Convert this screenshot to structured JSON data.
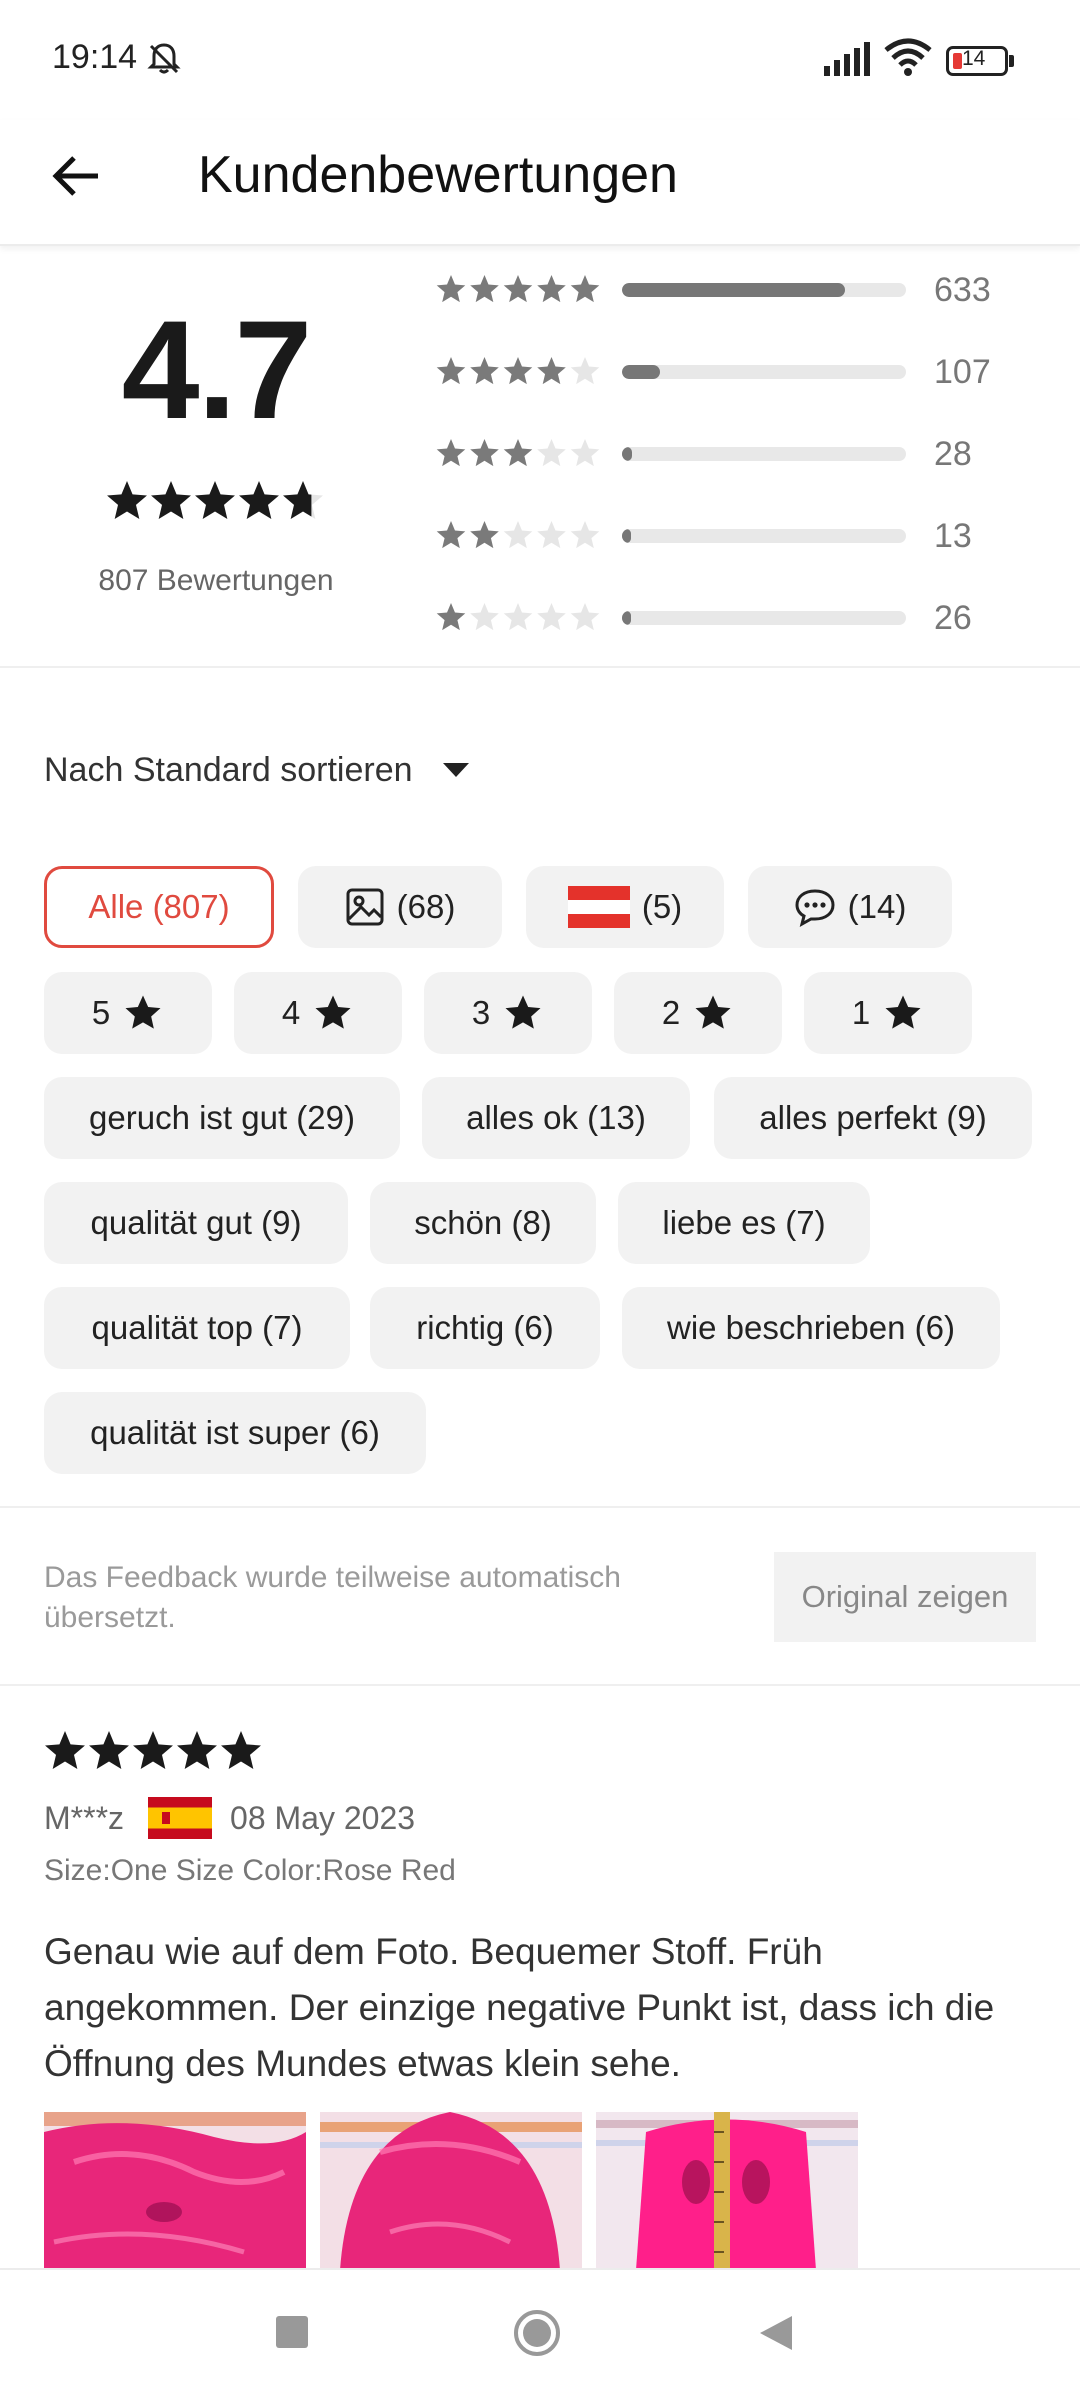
{
  "status_bar": {
    "time": "19:14",
    "battery_level": "14"
  },
  "header": {
    "title": "Kundenbewertungen"
  },
  "summary": {
    "average": "4.7",
    "average_stars_fraction": 0.94,
    "review_count_label": "807 Bewertungen",
    "distribution": [
      {
        "stars": 5,
        "count": "633",
        "fraction": 0.785
      },
      {
        "stars": 4,
        "count": "107",
        "fraction": 0.133
      },
      {
        "stars": 3,
        "count": "28",
        "fraction": 0.035
      },
      {
        "stars": 2,
        "count": "13",
        "fraction": 0.016
      },
      {
        "stars": 1,
        "count": "26",
        "fraction": 0.032
      }
    ]
  },
  "sort": {
    "label": "Nach Standard sortieren"
  },
  "filters": {
    "all": "Alle (807)",
    "photos": "(68)",
    "country": "(5)",
    "comments": "(14)",
    "star_filters": [
      "5",
      "4",
      "3",
      "2",
      "1"
    ],
    "tags": [
      "geruch ist gut (29)",
      "alles ok (13)",
      "alles perfekt (9)",
      "qualität gut (9)",
      "schön (8)",
      "liebe es (7)",
      "qualität top (7)",
      "richtig (6)",
      "wie beschrieben (6)",
      "qualität ist super (6)"
    ]
  },
  "translation_note": {
    "text": "Das Feedback wurde teilweise automatisch übersetzt.",
    "button": "Original zeigen"
  },
  "review": {
    "rating": 5,
    "author": "M***z",
    "date": "08 May 2023",
    "variant": "Size:One Size Color:Rose Red",
    "text": "Genau wie auf dem Foto. Bequemer Stoff. Früh angekommen. Der einzige negative Punkt ist, dass ich die Öffnung des Mundes etwas klein sehe."
  },
  "colors": {
    "accent": "#e04a3f",
    "star_filled": "#1a1a1a",
    "star_small": "#7a7a7a",
    "star_empty": "#e6e6e6",
    "photo_pink": "#e8267a"
  }
}
